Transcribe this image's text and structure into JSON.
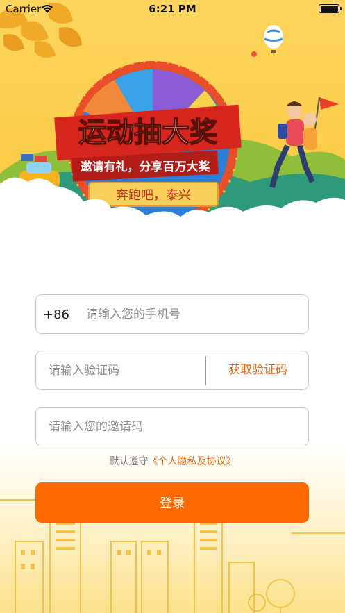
{
  "status_bar": {
    "carrier": "Carrier",
    "time": "6:21 PM"
  },
  "banner": {
    "title": "运动抽大奖",
    "subtitle": "邀请有礼，分享百万大奖",
    "ribbon": "奔跑吧，泰兴"
  },
  "form": {
    "phone": {
      "prefix": "+86",
      "placeholder": "请输入您的手机号",
      "value": ""
    },
    "code": {
      "placeholder": "请输入验证码",
      "value": "",
      "button_label": "获取验证码"
    },
    "invite": {
      "placeholder": "请输入您的邀请码",
      "value": ""
    }
  },
  "agreement": {
    "prefix": "默认遵守",
    "link": "《个人隐私及协议》"
  },
  "login_button": "登录",
  "colors": {
    "accent": "#ff6a00",
    "banner_bg": "#fcd35a",
    "link": "#ef6a10"
  }
}
